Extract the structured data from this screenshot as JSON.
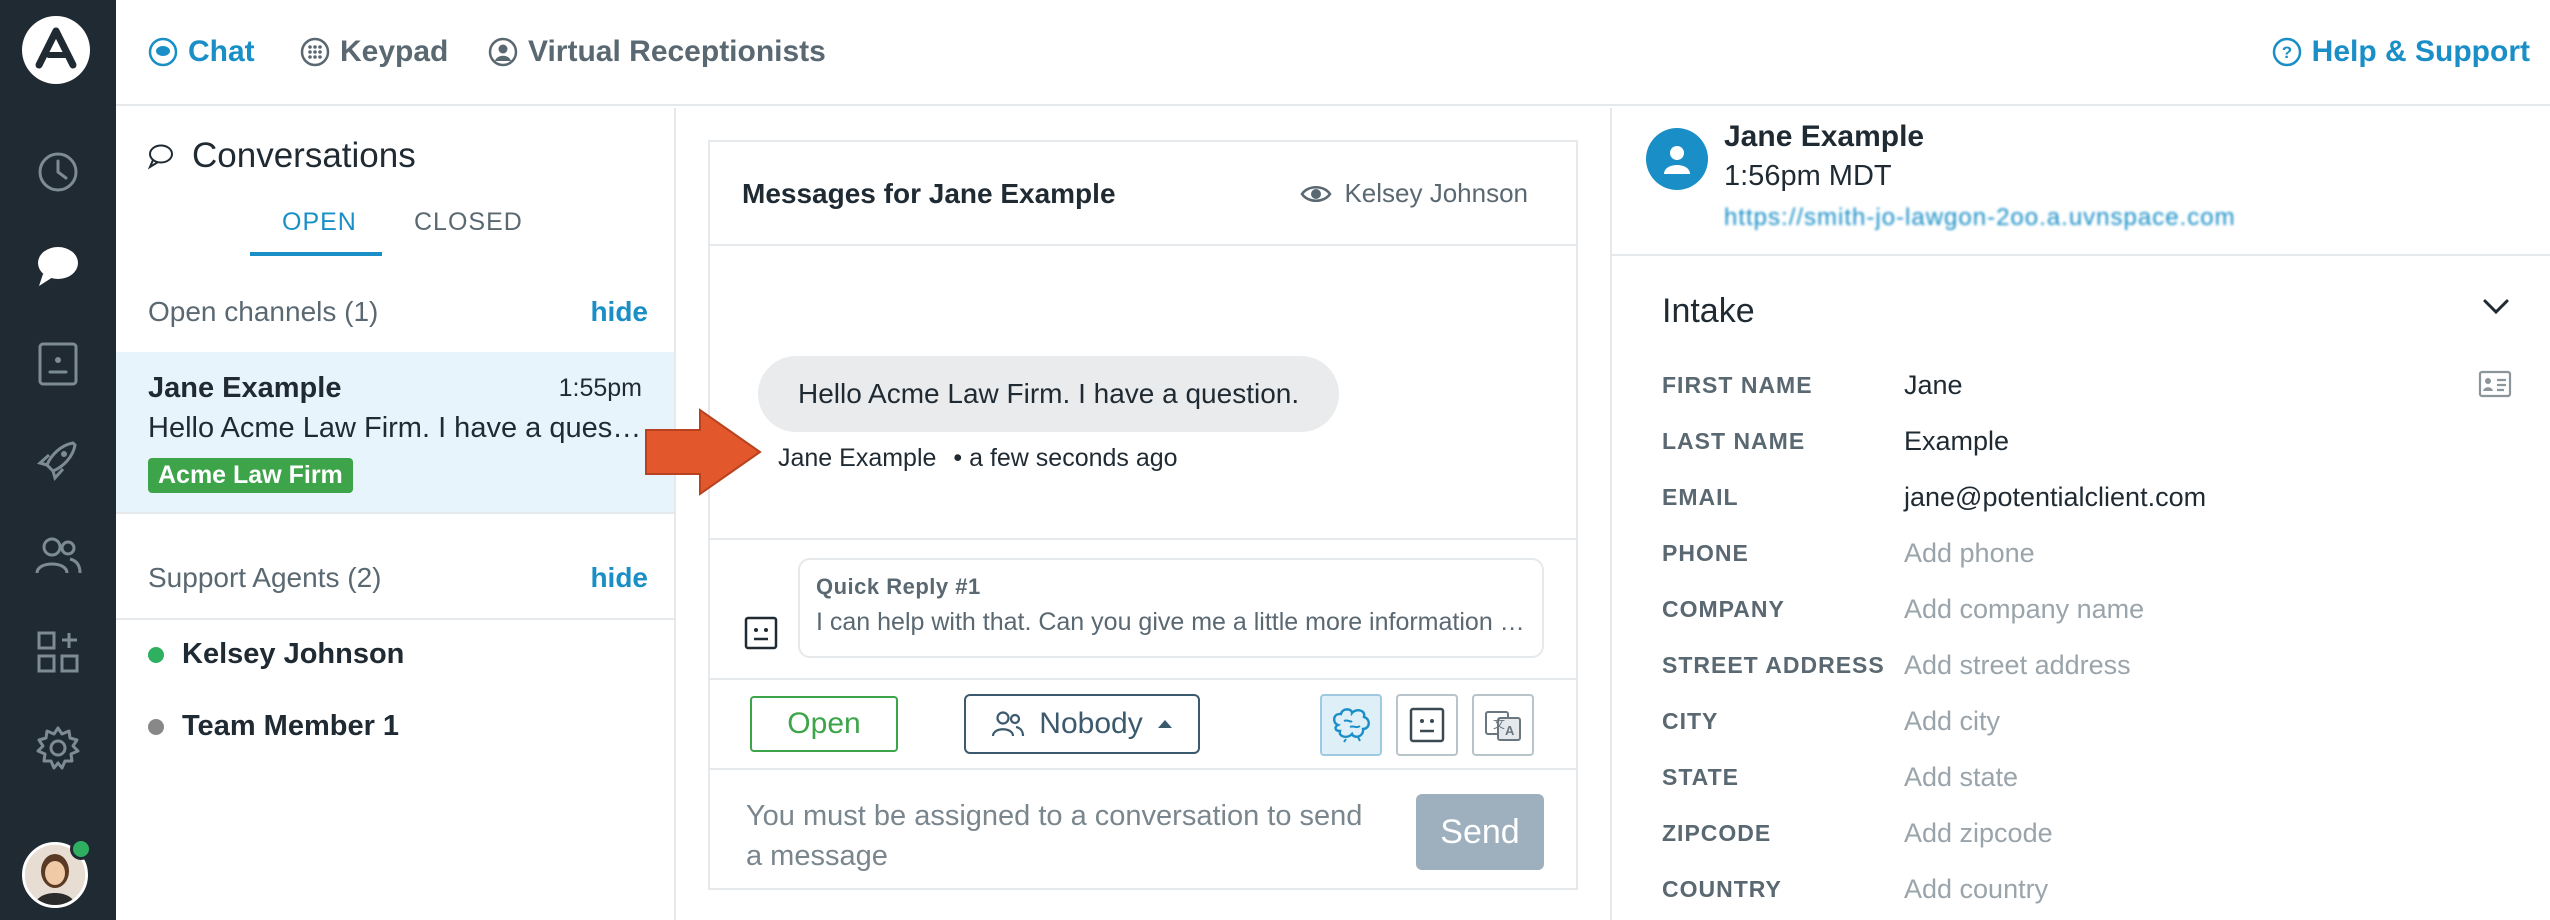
{
  "topnav": {
    "tabs": [
      {
        "label": "Chat",
        "icon": "chat-icon",
        "active": true
      },
      {
        "label": "Keypad",
        "icon": "keypad-icon",
        "active": false
      },
      {
        "label": "Virtual Receptionists",
        "icon": "receptionist-icon",
        "active": false
      }
    ],
    "help_label": "Help & Support"
  },
  "rail": {
    "icons": [
      "history-icon",
      "chat-icon",
      "contact-card-icon",
      "rocket-icon",
      "team-icon",
      "apps-icon",
      "gear-icon"
    ]
  },
  "conversations": {
    "title": "Conversations",
    "tabs": [
      "OPEN",
      "CLOSED"
    ],
    "open_channels": {
      "label": "Open channels (1)",
      "action": "hide"
    },
    "items": [
      {
        "name": "Jane Example",
        "time": "1:55pm",
        "preview": "Hello Acme Law Firm. I have a question.",
        "tag": "Acme Law Firm"
      }
    ],
    "support_agents": {
      "label": "Support Agents (2)",
      "action": "hide"
    },
    "agents": [
      {
        "name": "Kelsey Johnson",
        "status_color": "#2eb060"
      },
      {
        "name": "Team Member 1",
        "status_color": "#888888"
      }
    ]
  },
  "messages": {
    "title": "Messages for Jane Example",
    "watcher": "Kelsey Johnson",
    "bubble_text": "Hello Acme Law Firm. I have a question.",
    "sender": "Jane Example",
    "sent_ago": "• a few seconds ago",
    "quick_reply_label": "Quick Reply #1",
    "quick_reply_text": "I can help with that. Can you give me a little more information about your situation?",
    "open_button": "Open",
    "assign_label": "Nobody",
    "compose_placeholder": "You must be assigned to a conversation to send a message",
    "send_button": "Send"
  },
  "contact": {
    "name": "Jane Example",
    "time": "1:56pm MDT",
    "url": "https://smith-jo-lawgon-2oo.a.uvnspace.com",
    "intake_title": "Intake",
    "fields": [
      {
        "label": "FIRST NAME",
        "value": "Jane",
        "placeholder": false
      },
      {
        "label": "LAST NAME",
        "value": "Example",
        "placeholder": false
      },
      {
        "label": "EMAIL",
        "value": "jane@potentialclient.com",
        "placeholder": false
      },
      {
        "label": "PHONE",
        "value": "Add phone",
        "placeholder": true
      },
      {
        "label": "COMPANY",
        "value": "Add company name",
        "placeholder": true
      },
      {
        "label": "STREET ADDRESS",
        "value": "Add street address",
        "placeholder": true
      },
      {
        "label": "CITY",
        "value": "Add city",
        "placeholder": true
      },
      {
        "label": "STATE",
        "value": "Add state",
        "placeholder": true
      },
      {
        "label": "ZIPCODE",
        "value": "Add zipcode",
        "placeholder": true
      },
      {
        "label": "COUNTRY",
        "value": "Add country",
        "placeholder": true
      }
    ]
  },
  "colors": {
    "rail_bg": "#1f2a33",
    "accent": "#1a8fc7",
    "tag_green": "#3ea44a",
    "arrow": "#e2572b"
  }
}
